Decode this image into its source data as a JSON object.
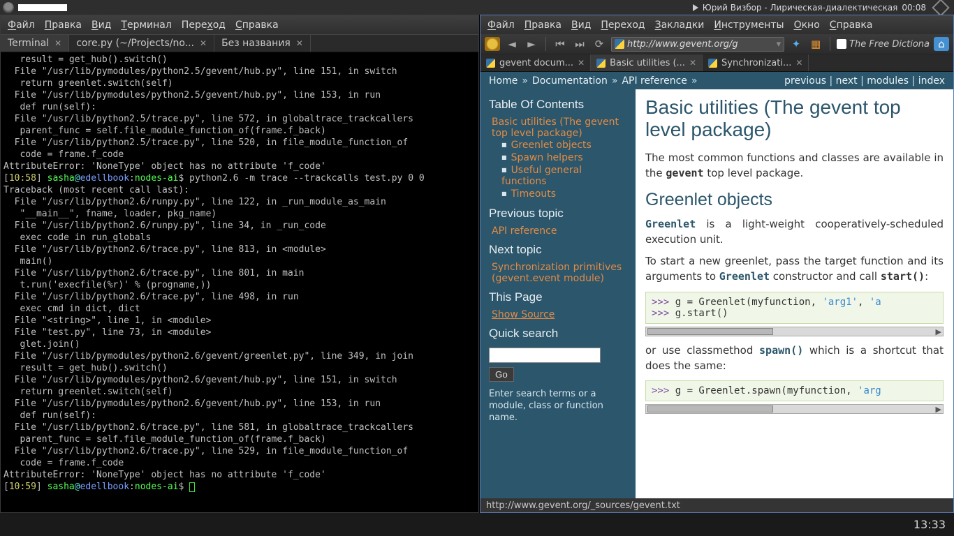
{
  "taskbar": {
    "music": "Юрий Визбор - Лирическая-диалектическая",
    "music_time": "00:08"
  },
  "bottom": {
    "clock": "13:33"
  },
  "left": {
    "menus": [
      "Файл",
      "Правка",
      "Вид",
      "Терминал",
      "Переход",
      "Справка"
    ],
    "tabs": [
      {
        "label": "Terminal",
        "active": true
      },
      {
        "label": "core.py (~/Projects/no...",
        "active": false
      },
      {
        "label": "Без названия",
        "active": false
      }
    ],
    "terminal_lines": [
      "   result = get_hub().switch()",
      "  File \"/usr/lib/pymodules/python2.5/gevent/hub.py\", line 151, in switch",
      "   return greenlet.switch(self)",
      "  File \"/usr/lib/pymodules/python2.5/gevent/hub.py\", line 153, in run",
      "   def run(self):",
      "  File \"/usr/lib/python2.5/trace.py\", line 572, in globaltrace_trackcallers",
      "   parent_func = self.file_module_function_of(frame.f_back)",
      "  File \"/usr/lib/python2.5/trace.py\", line 520, in file_module_function_of",
      "   code = frame.f_code",
      "AttributeError: 'NoneType' object has no attribute 'f_code'"
    ],
    "prompt1": {
      "time": "10:58",
      "user": "sasha",
      "host": "edellbook",
      "path": "nodes-ai",
      "cmd": "python2.6 -m trace --trackcalls test.py 0 0"
    },
    "traceback2": [
      "Traceback (most recent call last):",
      "  File \"/usr/lib/python2.6/runpy.py\", line 122, in _run_module_as_main",
      "   \"__main__\", fname, loader, pkg_name)",
      "  File \"/usr/lib/python2.6/runpy.py\", line 34, in _run_code",
      "   exec code in run_globals",
      "  File \"/usr/lib/python2.6/trace.py\", line 813, in <module>",
      "   main()",
      "  File \"/usr/lib/python2.6/trace.py\", line 801, in main",
      "   t.run('execfile(%r)' % (progname,))",
      "  File \"/usr/lib/python2.6/trace.py\", line 498, in run",
      "   exec cmd in dict, dict",
      "  File \"<string>\", line 1, in <module>",
      "  File \"test.py\", line 73, in <module>",
      "   glet.join()",
      "  File \"/usr/lib/pymodules/python2.6/gevent/greenlet.py\", line 349, in join",
      "   result = get_hub().switch()",
      "  File \"/usr/lib/pymodules/python2.6/gevent/hub.py\", line 151, in switch",
      "   return greenlet.switch(self)",
      "  File \"/usr/lib/pymodules/python2.6/gevent/hub.py\", line 153, in run",
      "   def run(self):",
      "  File \"/usr/lib/python2.6/trace.py\", line 581, in globaltrace_trackcallers",
      "   parent_func = self.file_module_function_of(frame.f_back)",
      "  File \"/usr/lib/python2.6/trace.py\", line 529, in file_module_function_of",
      "   code = frame.f_code",
      "AttributeError: 'NoneType' object has no attribute 'f_code'"
    ],
    "prompt2": {
      "time": "10:59",
      "user": "sasha",
      "host": "edellbook",
      "path": "nodes-ai",
      "cmd": ""
    }
  },
  "right": {
    "menus": [
      "Файл",
      "Правка",
      "Вид",
      "Переход",
      "Закладки",
      "Инструменты",
      "Окно",
      "Справка"
    ],
    "url": "http://www.gevent.org/g",
    "sidelabel": "The Free Dictiona",
    "tabs": [
      {
        "label": "gevent docum...",
        "active": false
      },
      {
        "label": "Basic utilities (...",
        "active": true
      },
      {
        "label": "Synchronizati...",
        "active": false
      }
    ],
    "crumb": {
      "home": "Home",
      "doc": "Documentation",
      "api": "API reference",
      "prev": "previous",
      "next": "next",
      "modules": "modules",
      "index": "index"
    },
    "sidebar": {
      "toc_title": "Table Of Contents",
      "toc_top": "Basic utilities (The gevent top level package)",
      "toc_items": [
        "Greenlet objects",
        "Spawn helpers",
        "Useful general functions",
        "Timeouts"
      ],
      "prev_h": "Previous topic",
      "prev": "API reference",
      "next_h": "Next topic",
      "next": "Synchronization primitives (gevent.event module)",
      "thispage_h": "This Page",
      "showsrc": "Show Source",
      "quick_h": "Quick search",
      "go": "Go",
      "hint": "Enter search terms or a module, class or function name."
    },
    "doc": {
      "h1": "Basic utilities (The gevent top level package)",
      "p1a": "The most common functions and classes are available in the ",
      "p1b": "gevent",
      "p1c": " top level package.",
      "h2": "Greenlet objects",
      "p2a": "Greenlet",
      "p2b": " is a light-weight cooperatively-scheduled execution unit.",
      "p3a": "To start a new greenlet, pass the target function and its arguments to ",
      "p3b": "Greenlet",
      "p3c": " constructor and call ",
      "p3d": "start()",
      "p3e": ":",
      "code1_l1": ">>> g = Greenlet(myfunction, 'arg1', 'a",
      "code1_l2": ">>> g.start()",
      "p4a": "or use classmethod ",
      "p4b": "spawn()",
      "p4c": " which is a shortcut that does the same:",
      "code2_l1": ">>> g = Greenlet.spawn(myfunction, 'arg"
    },
    "status": "http://www.gevent.org/_sources/gevent.txt"
  }
}
